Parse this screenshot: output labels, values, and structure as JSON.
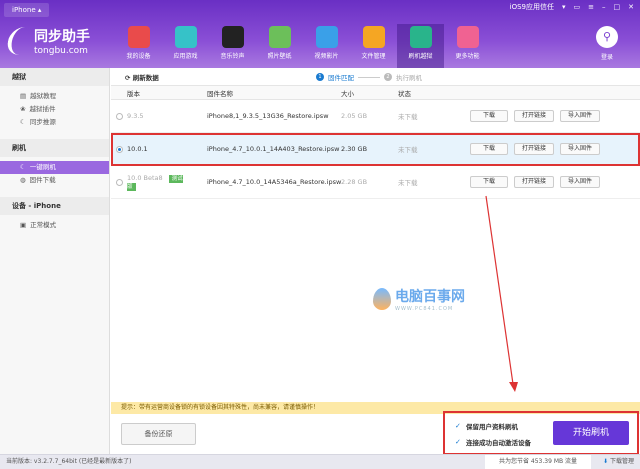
{
  "titlebar": {
    "device_tab": "iPhone ▴",
    "trust_label": "iOS9应用信任",
    "controls": [
      "▾",
      "▭",
      "≡",
      "–",
      "□",
      "✕"
    ]
  },
  "header": {
    "logo_cn": "同步助手",
    "logo_en": "tongbu.com",
    "login": "登录",
    "nav": [
      {
        "label": "我的设备",
        "color": "#e94b4b"
      },
      {
        "label": "应用游戏",
        "color": "#36c2c8"
      },
      {
        "label": "音乐铃声",
        "color": "#222222"
      },
      {
        "label": "照片壁纸",
        "color": "#6cbf5a"
      },
      {
        "label": "视频影片",
        "color": "#3aa0e8"
      },
      {
        "label": "文件管理",
        "color": "#f5a623"
      },
      {
        "label": "刷机越狱",
        "color": "#29b48b",
        "active": true
      },
      {
        "label": "更多功能",
        "color": "#f06292"
      }
    ]
  },
  "sidebar": {
    "sections": [
      {
        "title": "越狱",
        "items": [
          "越狱教程",
          "越狱插件",
          "同步推源"
        ]
      },
      {
        "title": "刷机",
        "items": [
          "一键刷机",
          "固件下载"
        ],
        "active": "一键刷机"
      },
      {
        "title": "设备 - iPhone",
        "items": [
          "正常模式"
        ]
      }
    ]
  },
  "toolbar": {
    "refresh": "刷新数据",
    "step1": "固件匹配",
    "step2": "执行刷机"
  },
  "table": {
    "headers": [
      "版本",
      "固件名称",
      "大小",
      "状态"
    ],
    "rows": [
      {
        "version": "9.3.5",
        "badge": "",
        "name": "iPhone8,1_9.3.5_13G36_Restore.ipsw",
        "size": "2.05 GB",
        "status": "未下载",
        "selected": false
      },
      {
        "version": "10.0.1",
        "badge": "",
        "name": "iPhone_4.7_10.0.1_14A403_Restore.ipsw",
        "size": "2.30 GB",
        "status": "未下载",
        "selected": true
      },
      {
        "version": "10.0 Beta8",
        "badge": "测试版",
        "name": "iPhone_4.7_10.0_14A5346a_Restore.ipsw",
        "size": "2.28 GB",
        "status": "未下载",
        "selected": false
      }
    ],
    "actions": [
      "下载",
      "打开链接",
      "导入固件"
    ]
  },
  "tip": "提示：带有运营商设备锁的有锁设备因其特殊性，尚未兼容，请谨慎操作！",
  "backup_button": "备份还原",
  "options": [
    {
      "label": "保留用户资料刷机",
      "checked": true
    },
    {
      "label": "连接成功自动激活设备",
      "checked": true
    }
  ],
  "start_button": "开始刷机",
  "statusbar": {
    "version": "当前版本: v3.2.7.7_64bit  (已经是最新版本了)",
    "saved": "共为您节省 453.39 MB 流量",
    "download_mgr": "下载管理"
  },
  "watermark": {
    "cn": "电脑百事网",
    "url": "WWW.PC841.COM"
  }
}
